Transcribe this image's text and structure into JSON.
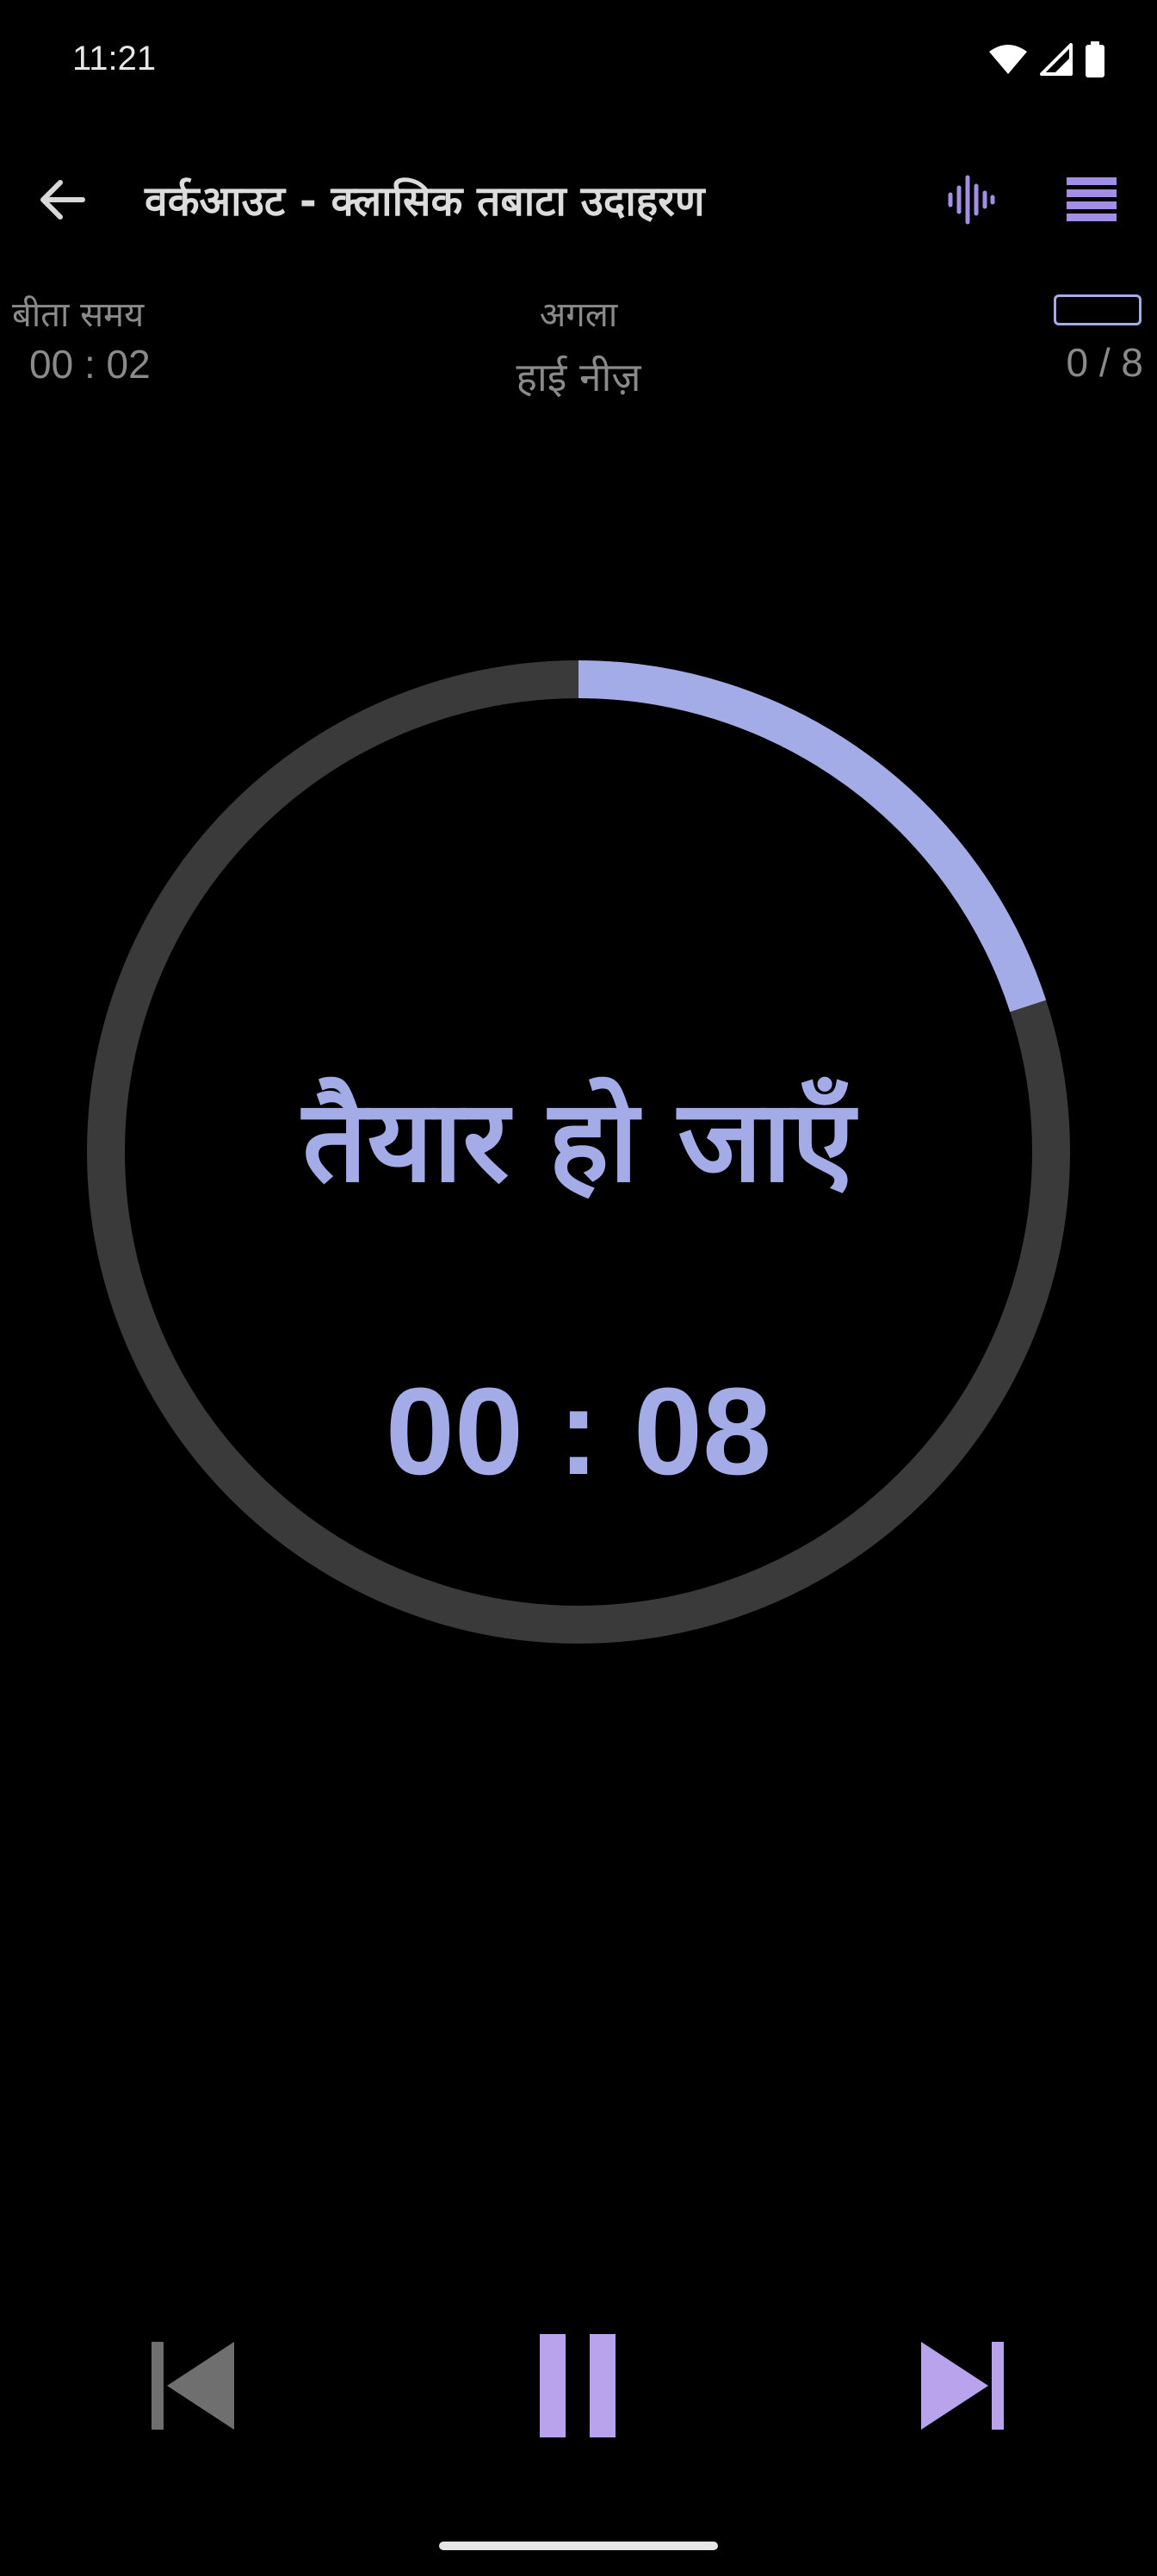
{
  "status_bar": {
    "time": "11:21",
    "icons": [
      "wifi-icon",
      "cellular-signal-icon",
      "battery-icon"
    ]
  },
  "app_bar": {
    "title": "वर्कआउट - क्लासिक तबाटा उदाहरण",
    "icons": [
      "back-arrow-icon",
      "sound-wave-icon",
      "menu-icon"
    ],
    "accent_color": "#a38ee6"
  },
  "info": {
    "elapsed_label": "बीता समय",
    "elapsed_value": "00 : 02",
    "next_label": "अगला",
    "next_value": "हाई नीज़",
    "rounds_value": "0 / 8",
    "rounds_progress": 0
  },
  "timer": {
    "phase": "तैयार हो जाएँ",
    "countdown": "00 : 08",
    "progress": 0.2,
    "progress_color": "#a4ace8",
    "track_color": "#3a3a3a"
  },
  "controls": {
    "icons": [
      "skip-previous-icon",
      "pause-icon",
      "skip-next-icon"
    ],
    "disabled_color": "#6f6f6f",
    "active_color": "#b9a3ec"
  }
}
